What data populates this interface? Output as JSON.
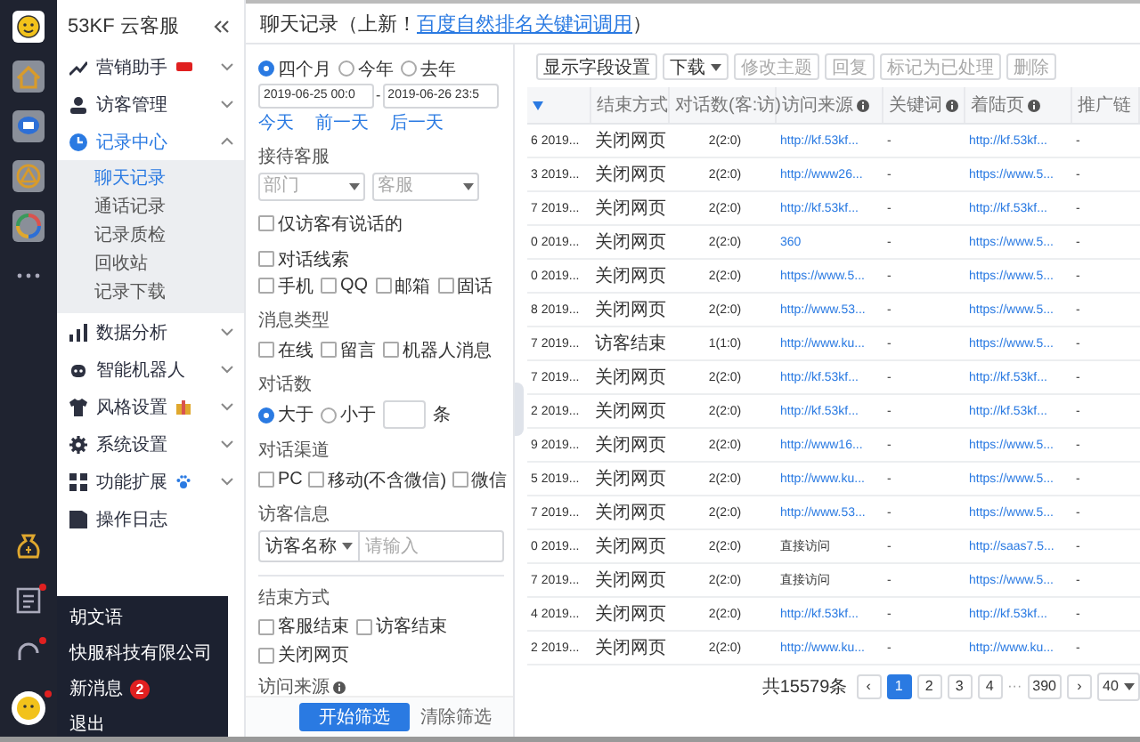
{
  "rail": {
    "items": [
      {
        "kind": "logo",
        "unread": false
      },
      {
        "kind": "home",
        "unread": false
      },
      {
        "kind": "chat",
        "unread": false
      },
      {
        "kind": "triangle",
        "unread": false
      },
      {
        "kind": "swirl",
        "unread": false
      },
      {
        "kind": "more",
        "unread": false
      }
    ],
    "bottom": [
      {
        "kind": "moneybag",
        "unread": false
      },
      {
        "kind": "document",
        "unread": true
      },
      {
        "kind": "headset",
        "unread": true
      },
      {
        "kind": "avatar",
        "unread": true
      }
    ]
  },
  "sidebar": {
    "title": "53KF 云客服",
    "items": [
      {
        "kind": "trend",
        "label": "营销助手",
        "new_tag": true,
        "expandable": true,
        "expanded": false,
        "selected": false
      },
      {
        "kind": "person",
        "label": "访客管理",
        "expandable": true,
        "expanded": false,
        "selected": false
      },
      {
        "kind": "clock",
        "label": "记录中心",
        "expandable": true,
        "expanded": true,
        "selected": true,
        "children": [
          {
            "label": "聊天记录",
            "selected": true
          },
          {
            "label": "通话记录",
            "selected": false
          },
          {
            "label": "记录质检",
            "selected": false
          },
          {
            "label": "回收站",
            "selected": false
          },
          {
            "label": "记录下载",
            "selected": false
          }
        ]
      },
      {
        "kind": "bars",
        "label": "数据分析",
        "expandable": true,
        "expanded": false,
        "selected": false
      },
      {
        "kind": "robot",
        "label": "智能机器人",
        "expandable": true,
        "expanded": false,
        "selected": false
      },
      {
        "kind": "shirt",
        "label": "风格设置",
        "gift": true,
        "expandable": true,
        "expanded": false,
        "selected": false
      },
      {
        "kind": "gear",
        "label": "系统设置",
        "expandable": true,
        "expanded": false,
        "selected": false
      },
      {
        "kind": "grid",
        "label": "功能扩展",
        "paw": true,
        "expandable": true,
        "expanded": false,
        "selected": false
      },
      {
        "kind": "book",
        "label": "操作日志",
        "expandable": false,
        "selected": false
      }
    ]
  },
  "user_menu": {
    "items": [
      {
        "label": "胡文语"
      },
      {
        "label": "快服科技有限公司"
      },
      {
        "label": "新消息",
        "badge": "2"
      },
      {
        "label": "退出"
      }
    ]
  },
  "header": {
    "title": "聊天记录（上新！",
    "link": "百度自然排名关键词调用",
    "suffix": "）"
  },
  "filters": {
    "period": [
      {
        "label": "四个月",
        "selected": true
      },
      {
        "label": "今年",
        "selected": false
      },
      {
        "label": "去年",
        "selected": false
      }
    ],
    "date_from": "2019-06-25 00:0",
    "date_to": "2019-06-26 23:5",
    "date_sep": "-",
    "quick_links": [
      "今天",
      "前一天",
      "后一天"
    ],
    "agent_label": "接待客服",
    "agent_selects": [
      {
        "placeholder": "部门"
      },
      {
        "placeholder": "客服"
      }
    ],
    "visitor_spoke": {
      "label": "仅访客有说话的",
      "checked": false
    },
    "clue": {
      "label": "对话线索",
      "checked": false
    },
    "clue_types": [
      {
        "label": "手机",
        "checked": false
      },
      {
        "label": "QQ",
        "checked": false
      },
      {
        "label": "邮箱",
        "checked": false
      },
      {
        "label": "固话",
        "checked": false
      }
    ],
    "message_type_label": "消息类型",
    "message_types": [
      {
        "label": "在线",
        "checked": false
      },
      {
        "label": "留言",
        "checked": false
      },
      {
        "label": "机器人消息",
        "checked": false
      }
    ],
    "count_label": "对话数",
    "count_compare": [
      {
        "label": "大于",
        "selected": true
      },
      {
        "label": "小于",
        "selected": false
      }
    ],
    "count_unit": "条",
    "channel_label": "对话渠道",
    "channels": [
      {
        "label": "PC",
        "checked": false
      },
      {
        "label": "移动(不含微信)",
        "checked": false
      },
      {
        "label": "微信",
        "checked": false
      }
    ],
    "visitor_label": "访客信息",
    "visitor_field": "访客名称",
    "visitor_placeholder": "请输入",
    "end_label": "结束方式",
    "end_types": [
      {
        "label": "客服结束",
        "checked": false
      },
      {
        "label": "访客结束",
        "checked": false
      },
      {
        "label": "关闭网页",
        "checked": false
      }
    ],
    "source_label": "访问来源",
    "apply": "开始筛选",
    "clear": "清除筛选"
  },
  "toolbar": [
    {
      "label": "显示字段设置",
      "disabled": false,
      "dropdown": false
    },
    {
      "label": "下载",
      "disabled": false,
      "dropdown": true
    },
    {
      "label": "修改主题",
      "disabled": true,
      "dropdown": false
    },
    {
      "label": "回复",
      "disabled": true,
      "dropdown": false
    },
    {
      "label": "标记为已处理",
      "disabled": true,
      "dropdown": false
    },
    {
      "label": "删除",
      "disabled": true,
      "dropdown": false
    }
  ],
  "table": {
    "columns": [
      {
        "filter_icon": true,
        "info": false
      },
      {
        "label": "结束方式",
        "filter_icon": false,
        "info": false
      },
      {
        "label": "对话数(客:访)",
        "filter_icon": false,
        "info": false
      },
      {
        "label": "访问来源",
        "filter_icon": false,
        "info": true
      },
      {
        "label": "关键词",
        "filter_icon": false,
        "info": true
      },
      {
        "label": "着陆页",
        "filter_icon": false,
        "info": true
      },
      {
        "label": "推广链",
        "filter_icon": false,
        "info": false
      }
    ],
    "rows": [
      {
        "column_1": "6 2019...",
        "end": "关闭网页",
        "count": "2(2:0)",
        "source": "http://kf.53kf...",
        "source_link": true,
        "keyword": "-",
        "landing": "http://kf.53kf...",
        "column_7": "-"
      },
      {
        "column_1": "3 2019...",
        "end": "关闭网页",
        "count": "2(2:0)",
        "source": "http://www26...",
        "source_link": true,
        "keyword": "-",
        "landing": "https://www.5...",
        "column_7": "-"
      },
      {
        "column_1": "7 2019...",
        "end": "关闭网页",
        "count": "2(2:0)",
        "source": "http://kf.53kf...",
        "source_link": true,
        "keyword": "-",
        "landing": "http://kf.53kf...",
        "column_7": "-"
      },
      {
        "column_1": "0 2019...",
        "end": "关闭网页",
        "count": "2(2:0)",
        "source": "360",
        "source_link": true,
        "keyword": "-",
        "landing": "https://www.5...",
        "column_7": "-"
      },
      {
        "column_1": "0 2019...",
        "end": "关闭网页",
        "count": "2(2:0)",
        "source": "https://www.5...",
        "source_link": true,
        "keyword": "-",
        "landing": "https://www.5...",
        "column_7": "-"
      },
      {
        "column_1": "8 2019...",
        "end": "关闭网页",
        "count": "2(2:0)",
        "source": "http://www.53...",
        "source_link": true,
        "keyword": "-",
        "landing": "https://www.5...",
        "column_7": "-"
      },
      {
        "column_1": "7 2019...",
        "end": "访客结束",
        "count": "1(1:0)",
        "source": "http://www.ku...",
        "source_link": true,
        "keyword": "-",
        "landing": "https://www.5...",
        "column_7": "-"
      },
      {
        "column_1": "7 2019...",
        "end": "关闭网页",
        "count": "2(2:0)",
        "source": "http://kf.53kf...",
        "source_link": true,
        "keyword": "-",
        "landing": "http://kf.53kf...",
        "column_7": "-"
      },
      {
        "column_1": "2 2019...",
        "end": "关闭网页",
        "count": "2(2:0)",
        "source": "http://kf.53kf...",
        "source_link": true,
        "keyword": "-",
        "landing": "http://kf.53kf...",
        "column_7": "-"
      },
      {
        "column_1": "9 2019...",
        "end": "关闭网页",
        "count": "2(2:0)",
        "source": "http://www16...",
        "source_link": true,
        "keyword": "-",
        "landing": "https://www.5...",
        "column_7": "-"
      },
      {
        "column_1": "5 2019...",
        "end": "关闭网页",
        "count": "2(2:0)",
        "source": "http://www.ku...",
        "source_link": true,
        "keyword": "-",
        "landing": "https://www.5...",
        "column_7": "-"
      },
      {
        "column_1": "7 2019...",
        "end": "关闭网页",
        "count": "2(2:0)",
        "source": "http://www.53...",
        "source_link": true,
        "keyword": "-",
        "landing": "https://www.5...",
        "column_7": "-"
      },
      {
        "column_1": "0 2019...",
        "end": "关闭网页",
        "count": "2(2:0)",
        "source": "直接访问",
        "source_link": false,
        "keyword": "-",
        "landing": "http://saas7.5...",
        "column_7": "-"
      },
      {
        "column_1": "7 2019...",
        "end": "关闭网页",
        "count": "2(2:0)",
        "source": "直接访问",
        "source_link": false,
        "keyword": "-",
        "landing": "https://www.5...",
        "column_7": "-"
      },
      {
        "column_1": "4 2019...",
        "end": "关闭网页",
        "count": "2(2:0)",
        "source": "http://kf.53kf...",
        "source_link": true,
        "keyword": "-",
        "landing": "http://kf.53kf...",
        "column_7": "-"
      },
      {
        "column_1": "2 2019...",
        "end": "关闭网页",
        "count": "2(2:0)",
        "source": "http://www.ku...",
        "source_link": true,
        "keyword": "-",
        "landing": "http://www.ku...",
        "column_7": "-"
      }
    ]
  },
  "pagination": {
    "total": "共15579条",
    "prev": "‹",
    "next": "›",
    "ellipsis": "···",
    "pages": [
      {
        "label": "1",
        "selected": true
      },
      {
        "label": "2",
        "selected": false
      },
      {
        "label": "3",
        "selected": false
      },
      {
        "label": "4",
        "selected": false
      }
    ],
    "last": "390",
    "page_size": "40"
  }
}
